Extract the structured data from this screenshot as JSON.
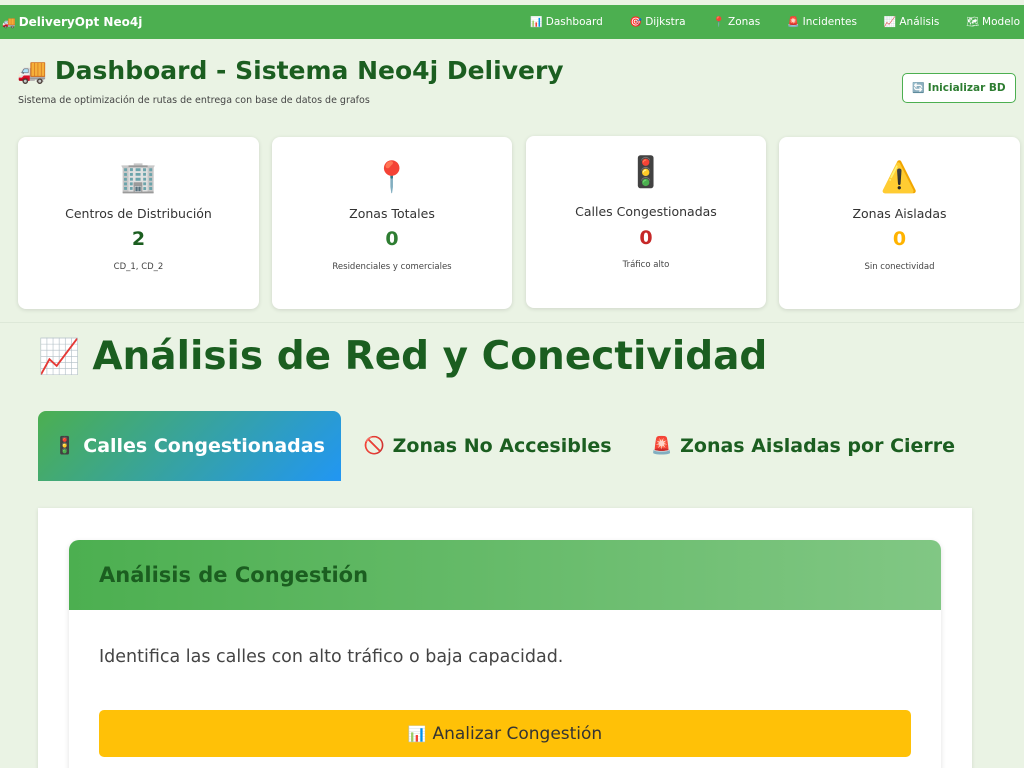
{
  "navbar": {
    "brand_icon": "delivery-truck-icon",
    "brand": "DeliveryOpt Neo4j",
    "items": [
      {
        "icon": "dashboard-icon",
        "glyph": "📊",
        "label": "Dashboard"
      },
      {
        "icon": "target-icon",
        "glyph": "🎯",
        "label": "Dijkstra"
      },
      {
        "icon": "pin-icon",
        "glyph": "📍",
        "label": "Zonas"
      },
      {
        "icon": "alert-icon",
        "glyph": "🚨",
        "label": "Incidentes"
      },
      {
        "icon": "chart-icon",
        "glyph": "📈",
        "label": "Análisis"
      },
      {
        "icon": "map-icon",
        "glyph": "🗺",
        "label": "Modelo"
      }
    ]
  },
  "header": {
    "title": "Dashboard - Sistema Neo4j Delivery",
    "subtitle": "Sistema de optimización de rutas de entrega con base de datos de grafos",
    "init_button": "Inicializar BD"
  },
  "stats": [
    {
      "icon": "building-icon",
      "label": "Centros de Distribución",
      "value": "2",
      "desc": "CD_1, CD_2",
      "color": "#1b5e20"
    },
    {
      "icon": "pin-icon",
      "label": "Zonas Totales",
      "value": "0",
      "desc": "Residenciales y comerciales",
      "color": "#2e7d32"
    },
    {
      "icon": "traffic-light-icon",
      "label": "Calles Congestionadas",
      "value": "0",
      "desc": "Tráfico alto",
      "color": "#c62828"
    },
    {
      "icon": "warning-icon",
      "label": "Zonas Aisladas",
      "value": "0",
      "desc": "Sin conectividad",
      "color": "#ffb300"
    }
  ],
  "section": {
    "title": "Análisis de Red y Conectividad",
    "tabs": [
      {
        "icon": "traffic-light-icon",
        "label": "Calles Congestionadas",
        "active": true
      },
      {
        "icon": "prohibited-icon",
        "label": "Zonas No Accesibles",
        "active": false
      },
      {
        "icon": "alert-icon",
        "label": "Zonas Aisladas por Cierre",
        "active": false
      }
    ]
  },
  "panel": {
    "title": "Análisis de Congestión",
    "description": "Identifica las calles con alto tráfico o baja capacidad.",
    "button": "Analizar Congestión"
  }
}
